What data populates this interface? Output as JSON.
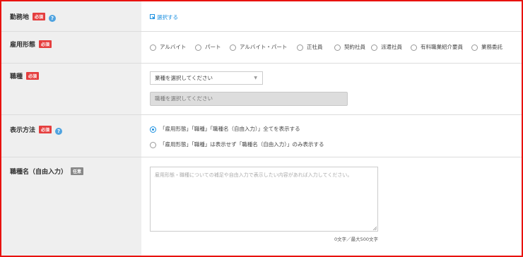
{
  "rows": {
    "workplace": {
      "label": "勤務地",
      "required": "必須",
      "help": "?",
      "link": "選択する"
    },
    "employment": {
      "label": "雇用形態",
      "required": "必須",
      "options": [
        "アルバイト",
        "パート",
        "アルバイト・パート",
        "正社員",
        "契約社員",
        "派遣社員",
        "有料職業紹介要員",
        "業務委託"
      ]
    },
    "job": {
      "label": "職種",
      "required": "必須",
      "select1": "業種を選択してください",
      "select2": "職種を選択してください"
    },
    "display": {
      "label": "表示方法",
      "required": "必須",
      "help": "?",
      "options": [
        "「雇用形態」「職種」「職種名（自由入力）」全てを表示する",
        "「雇用形態」「職種」は表示せず「職種名（自由入力）」のみ表示する"
      ],
      "selected_index": 0
    },
    "job_name": {
      "label": "職種名（自由入力）",
      "optional": "任意",
      "placeholder": "雇用形態・職種についての補足や自由入力で表示したい内容があれば入力してください。",
      "counter": "0文字／最大500文字"
    }
  },
  "colors": {
    "accent": "#1a8fe0",
    "required_badge": "#e53e3e",
    "frame": "#e8120f"
  }
}
